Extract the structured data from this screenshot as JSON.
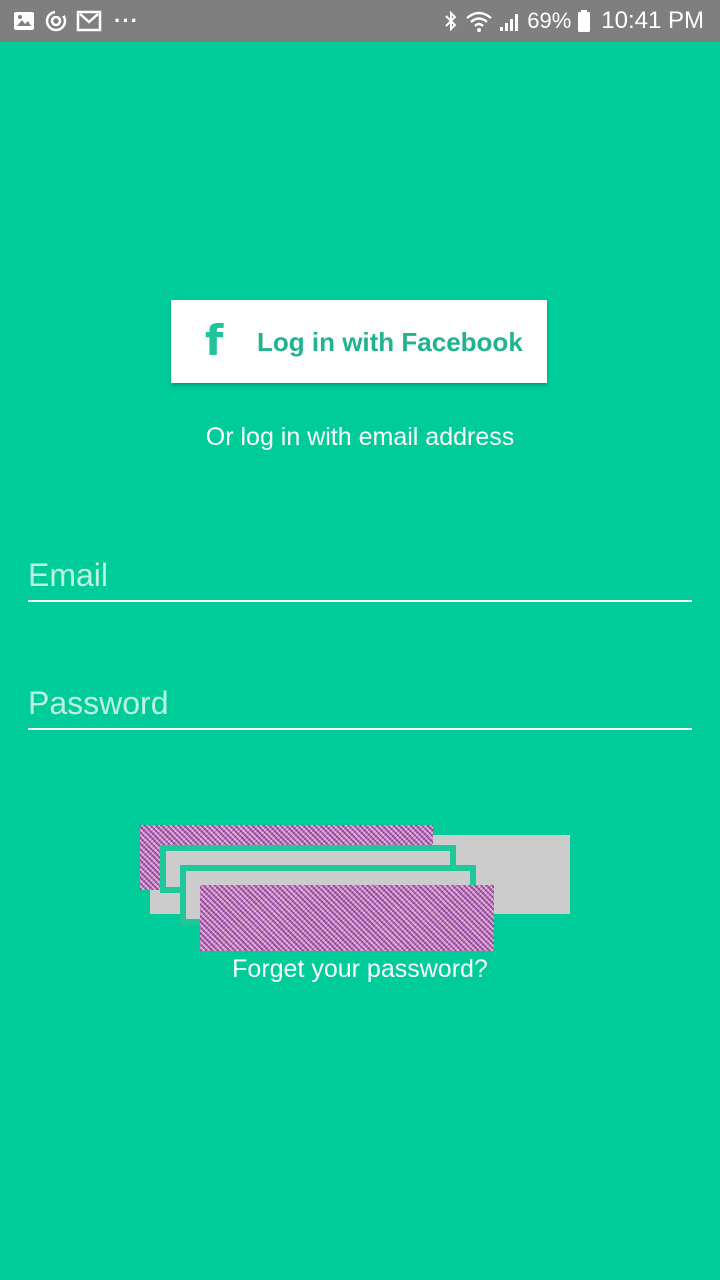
{
  "status_bar": {
    "left_icons": [
      "image-icon",
      "sync-icon",
      "gmail-icon"
    ],
    "more_indicator": "···",
    "right_icons": [
      "bluetooth-icon",
      "wifi-icon",
      "signal-icon",
      "battery-icon"
    ],
    "battery_percent": "69%",
    "time": "10:41 PM"
  },
  "facebook_button": {
    "icon_glyph": "f",
    "label": "Log in with Facebook"
  },
  "divider_text": "Or log in with email address",
  "form": {
    "email": {
      "placeholder": "Email",
      "value": ""
    },
    "password": {
      "placeholder": "Password",
      "value": ""
    }
  },
  "forgot_link": "Forget your password?",
  "colors": {
    "background": "#00cc9a",
    "status_bar": "#7f7f7f",
    "button_text": "#1fb48f",
    "placeholder": "#bdf2e3"
  }
}
